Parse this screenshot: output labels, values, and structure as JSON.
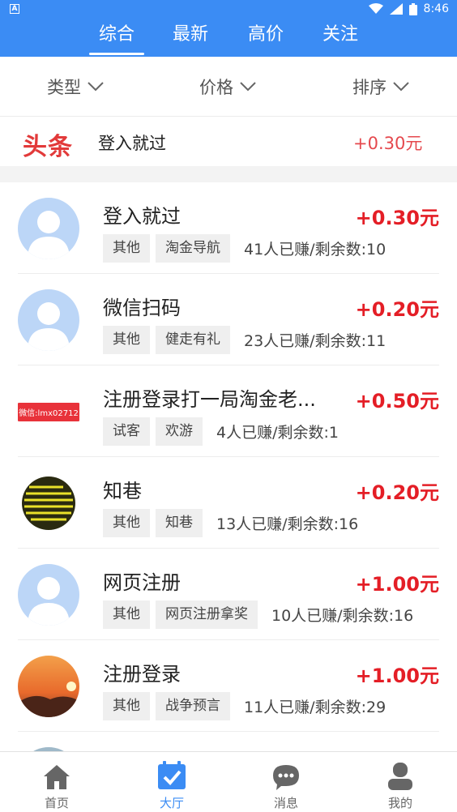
{
  "status_bar": {
    "notification_badge": "A",
    "time": "8:46"
  },
  "tabs": [
    {
      "label": "综合",
      "active": true
    },
    {
      "label": "最新",
      "active": false
    },
    {
      "label": "高价",
      "active": false
    },
    {
      "label": "关注",
      "active": false
    }
  ],
  "filters": [
    {
      "label": "类型"
    },
    {
      "label": "价格"
    },
    {
      "label": "排序"
    }
  ],
  "banner": {
    "logo_text": "头条",
    "title": "登入就过",
    "price": "+0.30元"
  },
  "tasks": [
    {
      "name": "登入就过",
      "price": "+0.30元",
      "tags": [
        "其他",
        "淘金导航"
      ],
      "stat": "41人已赚/剩余数:10",
      "avatar": "default-avatar"
    },
    {
      "name": "微信扫码",
      "price": "+0.20元",
      "tags": [
        "其他",
        "健走有礼"
      ],
      "stat": "23人已赚/剩余数:11",
      "avatar": "default-avatar"
    },
    {
      "name": "注册登录打一局淘金老...",
      "price": "+0.50元",
      "tags": [
        "试客",
        "欢游"
      ],
      "stat": "4人已赚/剩余数:1",
      "avatar": "wechat-id-badge",
      "avatar_text": "微信:lmx02712"
    },
    {
      "name": "知巷",
      "price": "+0.20元",
      "tags": [
        "其他",
        "知巷"
      ],
      "stat": "13人已赚/剩余数:16",
      "avatar": "yellow-text-poster"
    },
    {
      "name": "网页注册",
      "price": "+1.00元",
      "tags": [
        "其他",
        "网页注册拿奖"
      ],
      "stat": "10人已赚/剩余数:16",
      "avatar": "default-avatar"
    },
    {
      "name": "注册登录",
      "price": "+1.00元",
      "tags": [
        "其他",
        "战争预言"
      ],
      "stat": "11人已赚/剩余数:29",
      "avatar": "sunset-photo"
    }
  ],
  "bottom_nav": [
    {
      "label": "首页",
      "icon": "home-icon",
      "active": false
    },
    {
      "label": "大厅",
      "icon": "calendar-check-icon",
      "active": true
    },
    {
      "label": "消息",
      "icon": "chat-bubble-icon",
      "active": false
    },
    {
      "label": "我的",
      "icon": "user-icon",
      "active": false
    }
  ],
  "colors": {
    "primary": "#3b8cf4",
    "price_red": "#e41e26",
    "banner_red": "#e23a3a"
  }
}
